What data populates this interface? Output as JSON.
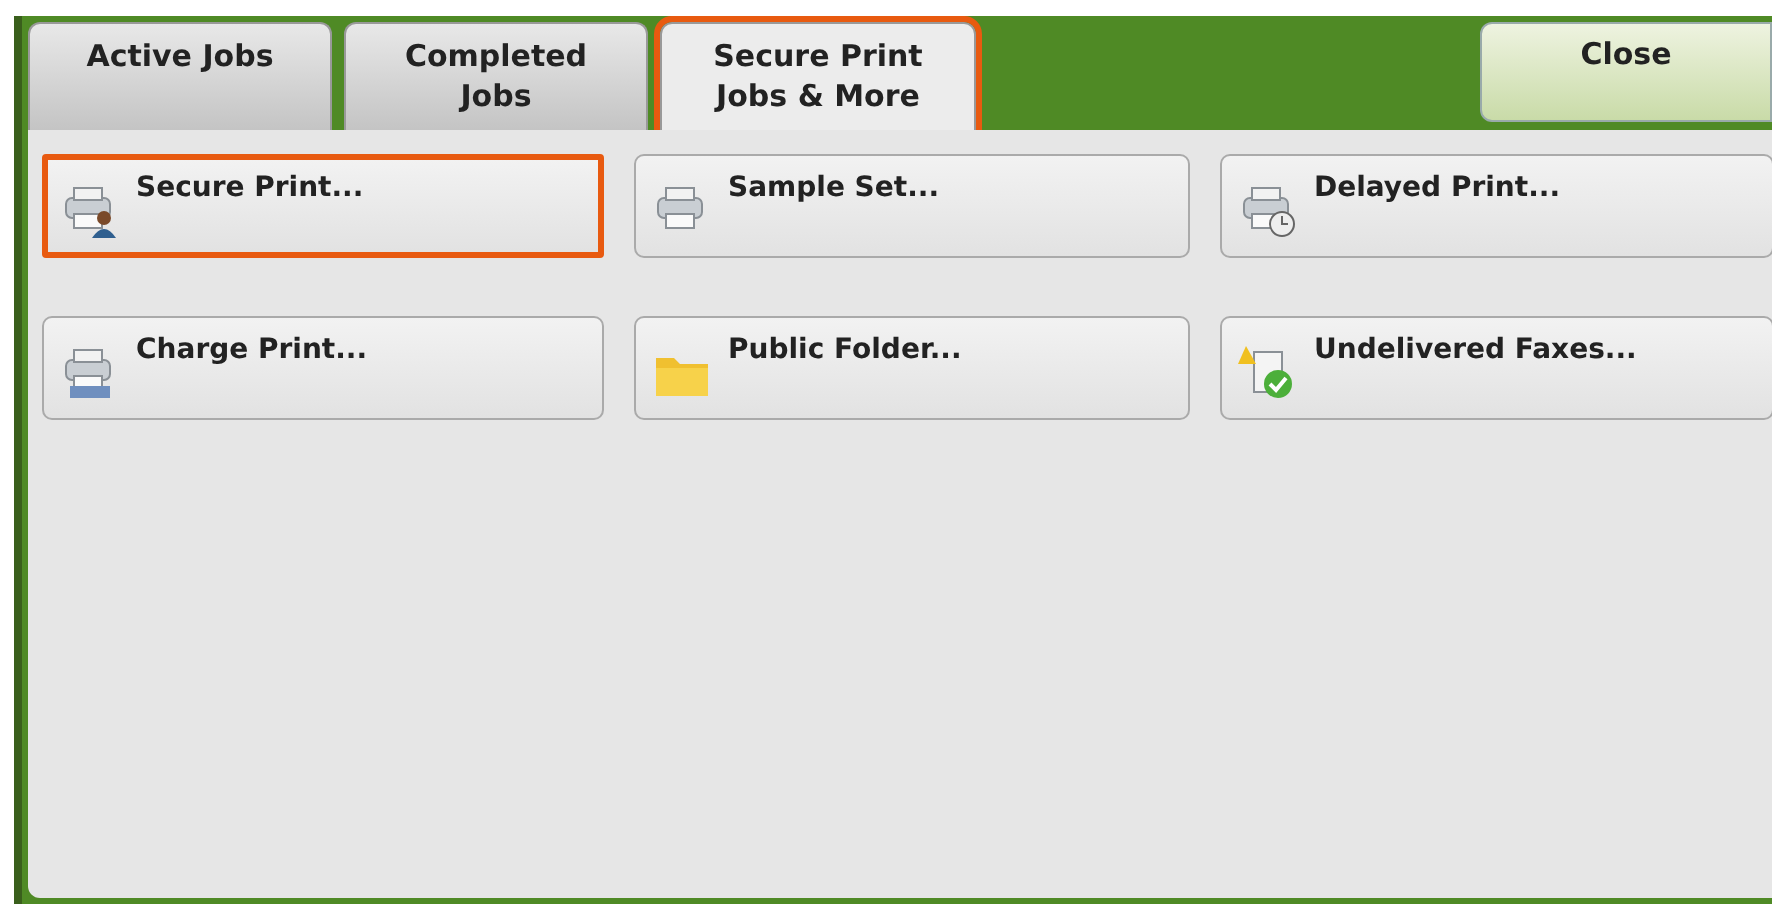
{
  "tabs": [
    {
      "label": "Active Jobs",
      "selected": false,
      "highlighted": false
    },
    {
      "label": "Completed\nJobs",
      "selected": false,
      "highlighted": false
    },
    {
      "label": "Secure Print\nJobs & More",
      "selected": true,
      "highlighted": true
    }
  ],
  "close_button": {
    "label": "Close"
  },
  "buttons": [
    {
      "label": "Secure Print...",
      "highlighted": true
    },
    {
      "label": "Sample Set...",
      "highlighted": false
    },
    {
      "label": "Delayed Print...",
      "highlighted": false
    },
    {
      "label": "Charge Print...",
      "highlighted": false
    },
    {
      "label": "Public Folder...",
      "highlighted": false
    },
    {
      "label": "Undelivered Faxes...",
      "highlighted": false
    }
  ]
}
